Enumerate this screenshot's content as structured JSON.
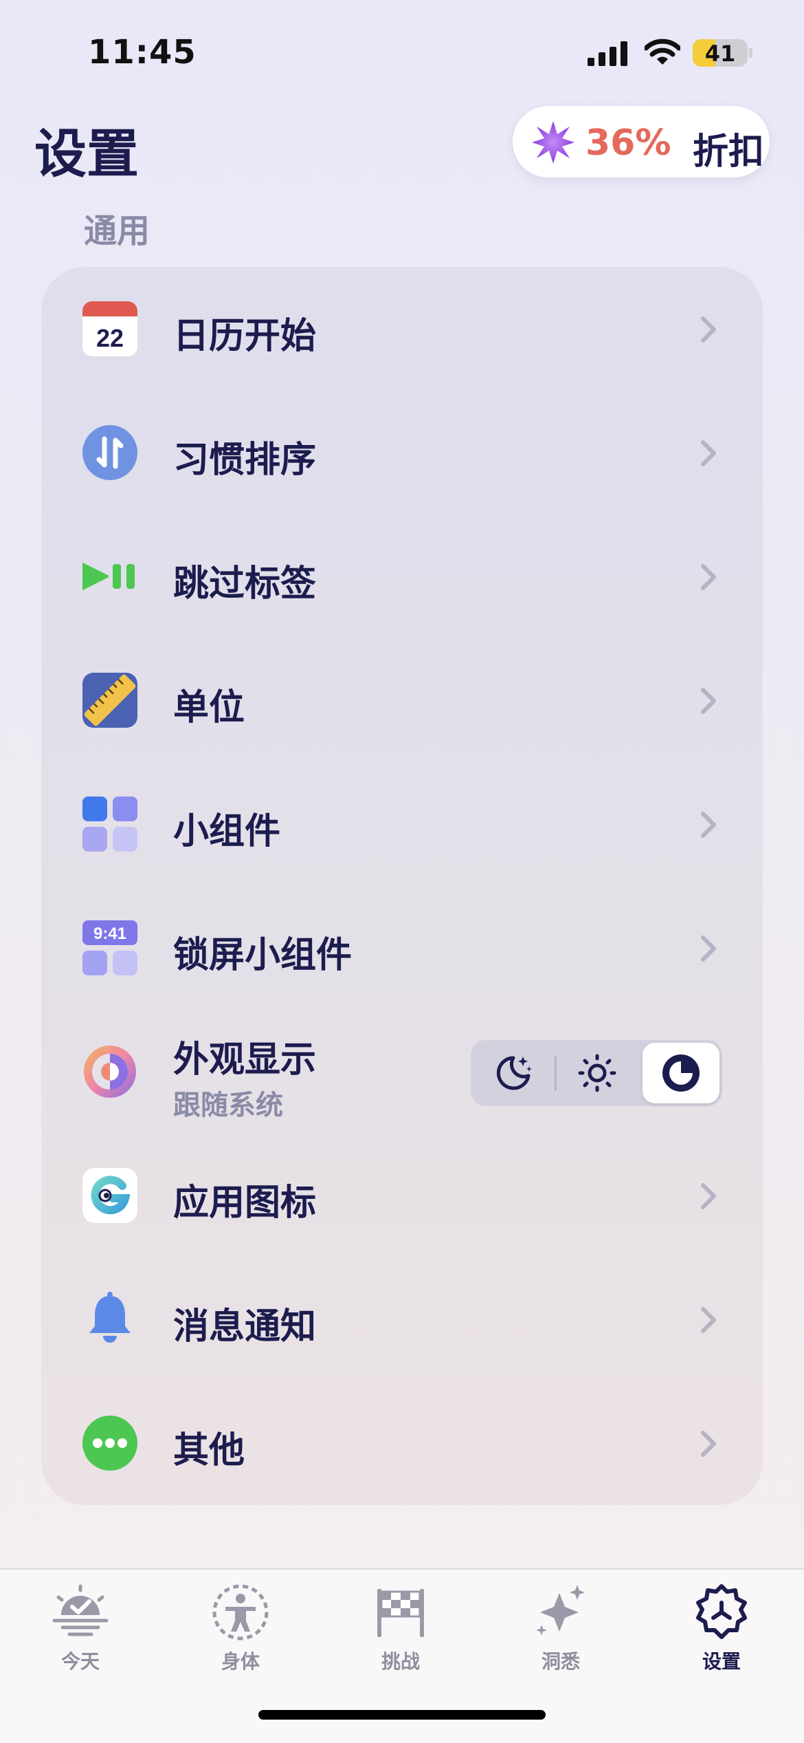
{
  "status": {
    "time": "11:45",
    "battery": "41",
    "battery_level": 0.41
  },
  "header": {
    "title": "设置",
    "discount_pct": "36%",
    "discount_label": "折扣"
  },
  "section": {
    "title": "通用"
  },
  "settings": {
    "calendar_start": {
      "label": "日历开始",
      "icon_number": "22"
    },
    "habit_order": {
      "label": "习惯排序"
    },
    "skip_label": {
      "label": "跳过标签"
    },
    "units": {
      "label": "单位"
    },
    "widgets": {
      "label": "小组件"
    },
    "lock_widgets": {
      "label": "锁屏小组件",
      "icon_time": "9:41"
    },
    "appearance": {
      "label": "外观显示",
      "value": "跟随系统",
      "options": [
        "dark",
        "light",
        "system"
      ],
      "selected": "system"
    },
    "app_icon": {
      "label": "应用图标"
    },
    "notifications": {
      "label": "消息通知"
    },
    "other": {
      "label": "其他"
    }
  },
  "tabbar": {
    "today": "今天",
    "body": "身体",
    "challenge": "挑战",
    "insights": "洞悉",
    "settings": "设置",
    "active": "settings"
  },
  "colors": {
    "accent": "#1c1c4e",
    "discount": "#e4695c",
    "secondary_text": "#8b8aa6",
    "chevron": "#b5b3c4"
  }
}
